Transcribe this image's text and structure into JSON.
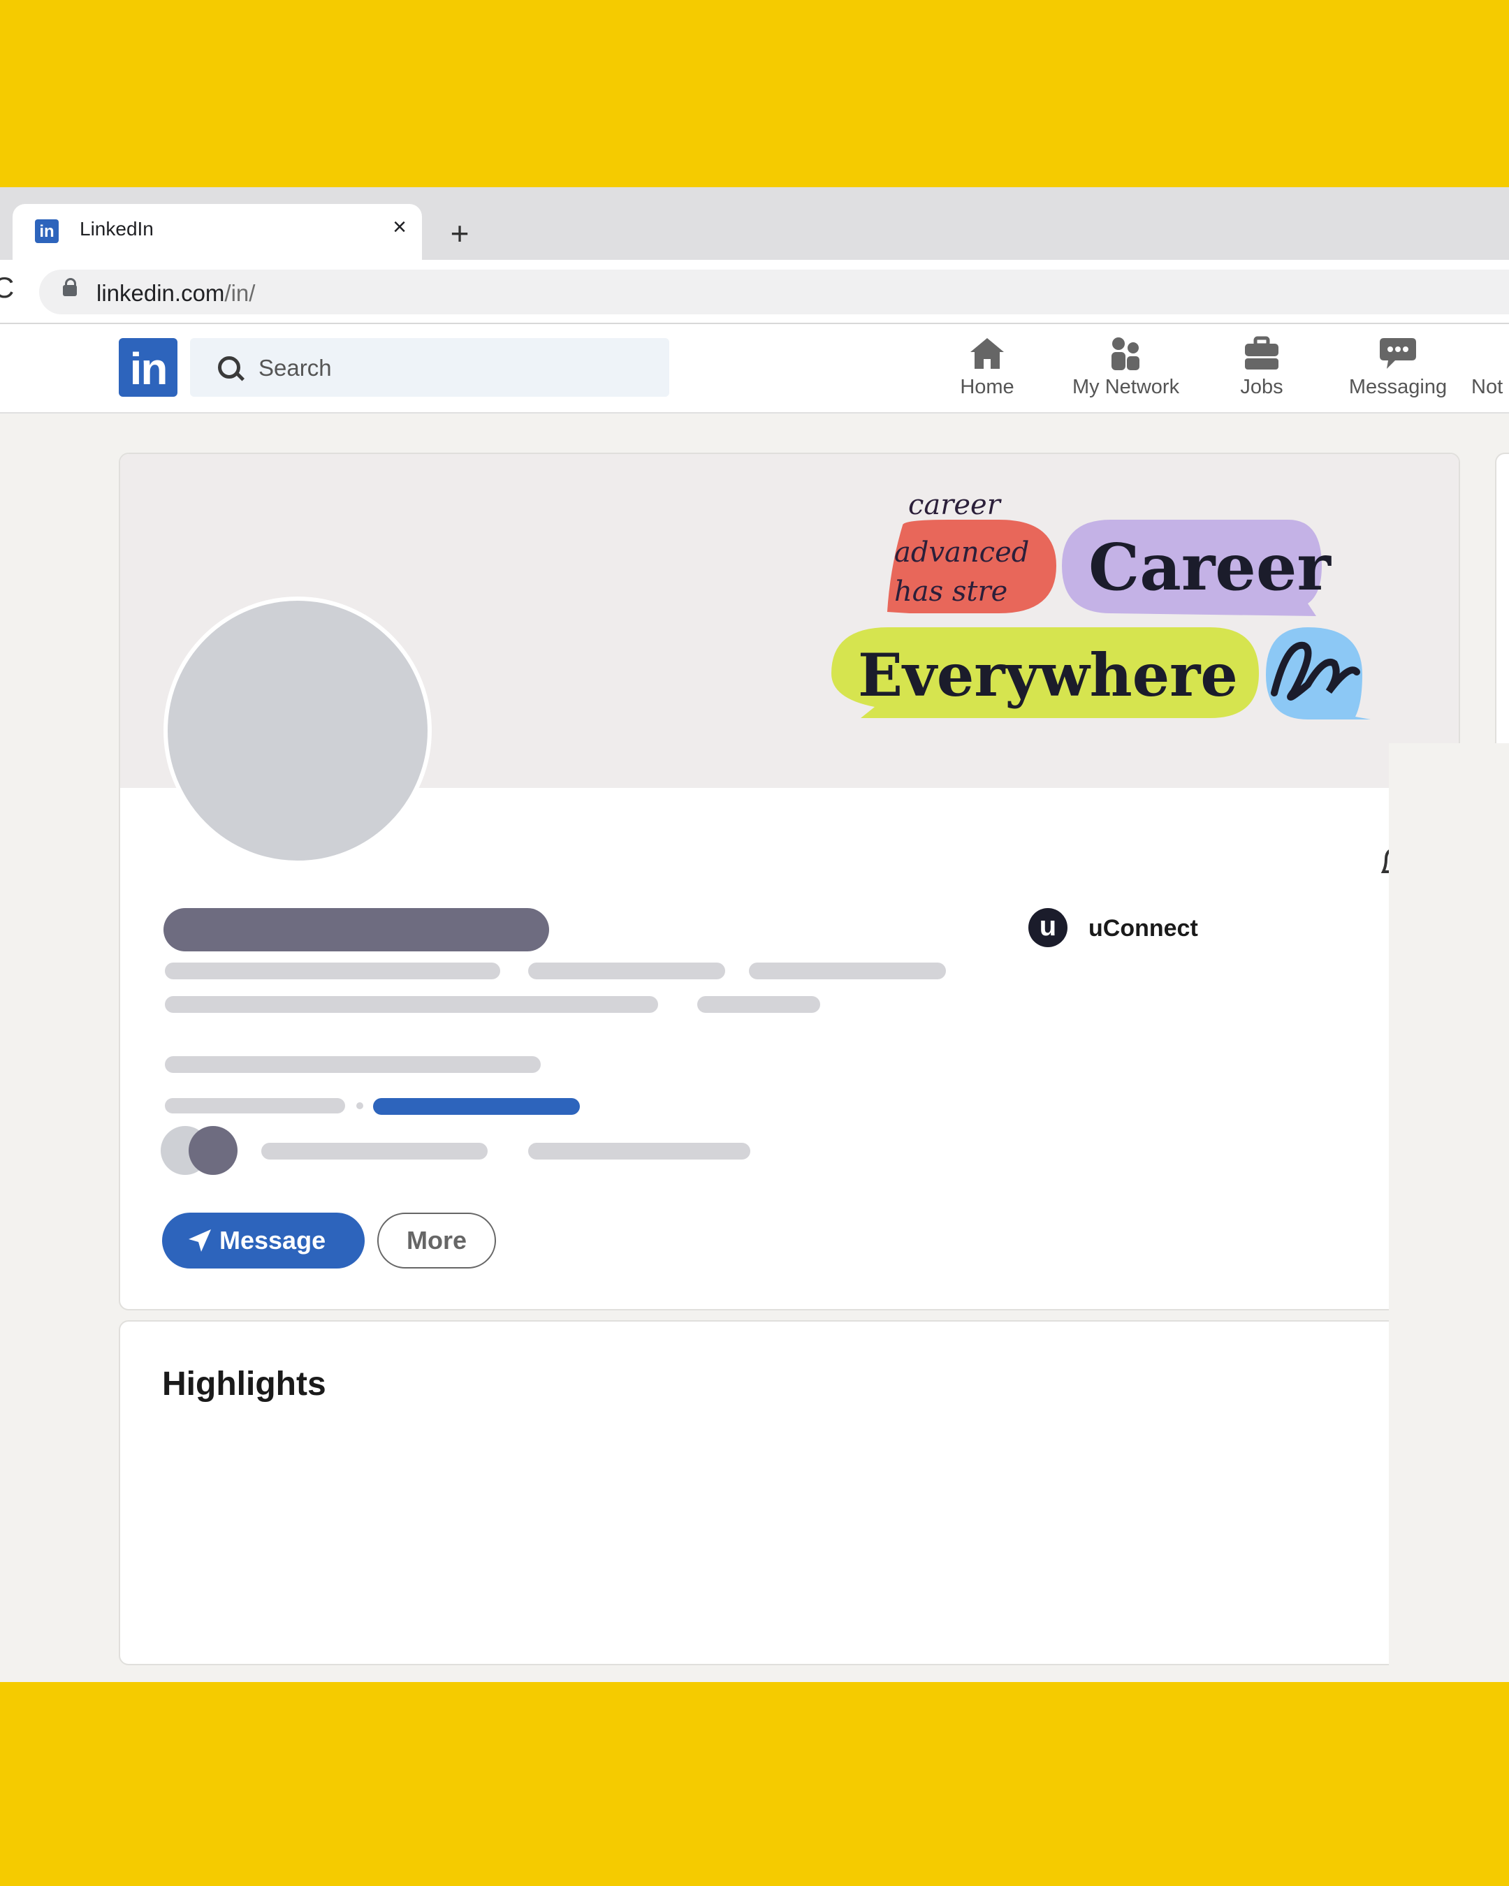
{
  "browser": {
    "tab_title": "LinkedIn",
    "tab_favicon": "in",
    "tab_close_icon": "×",
    "new_tab_icon": "+",
    "reload_icon": "C",
    "url_domain": "linkedin.com",
    "url_path": "/in/"
  },
  "navbar": {
    "logo": "in",
    "search_placeholder": "Search",
    "items": [
      {
        "label": "Home",
        "icon": "home-icon"
      },
      {
        "label": "My Network",
        "icon": "people-icon"
      },
      {
        "label": "Jobs",
        "icon": "briefcase-icon"
      },
      {
        "label": "Messaging",
        "icon": "chat-icon"
      },
      {
        "label": "Not",
        "icon": "bell-icon"
      }
    ]
  },
  "banner": {
    "handwriting": [
      "career",
      "advanced",
      "has stre"
    ],
    "word1": "Career",
    "word2": "Everywhere"
  },
  "profile": {
    "company_logo": "u",
    "company": "uConnect",
    "message_button": "Message",
    "more_button": "More"
  },
  "highlights": {
    "title": "Highlights"
  },
  "colors": {
    "brand_blue": "#2d64bc",
    "frame_yellow": "#f5cb00",
    "bubble_red": "#e8675a",
    "bubble_purple": "#c4b2e6",
    "bubble_green": "#d6e44f",
    "bubble_blue": "#8cc8f5"
  }
}
